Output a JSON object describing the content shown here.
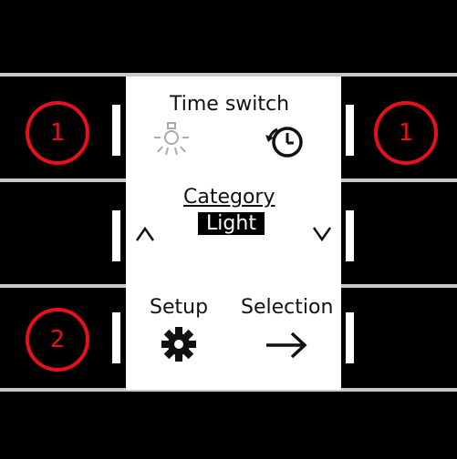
{
  "screen": {
    "title": "Time switch",
    "category_label": "Category",
    "category_value": "Light",
    "setup_label": "Setup",
    "selection_label": "Selection"
  },
  "markers": {
    "top_left": "1",
    "top_right": "1",
    "bottom_left": "2"
  },
  "colors": {
    "background": "#000000",
    "screen": "#ffffff",
    "marker": "#e8101a",
    "divider": "#c8c8c8"
  },
  "icons": [
    "light-bulb-icon",
    "timer-clock-icon",
    "chevron-up-icon",
    "chevron-down-icon",
    "gear-icon",
    "arrow-right-icon"
  ]
}
